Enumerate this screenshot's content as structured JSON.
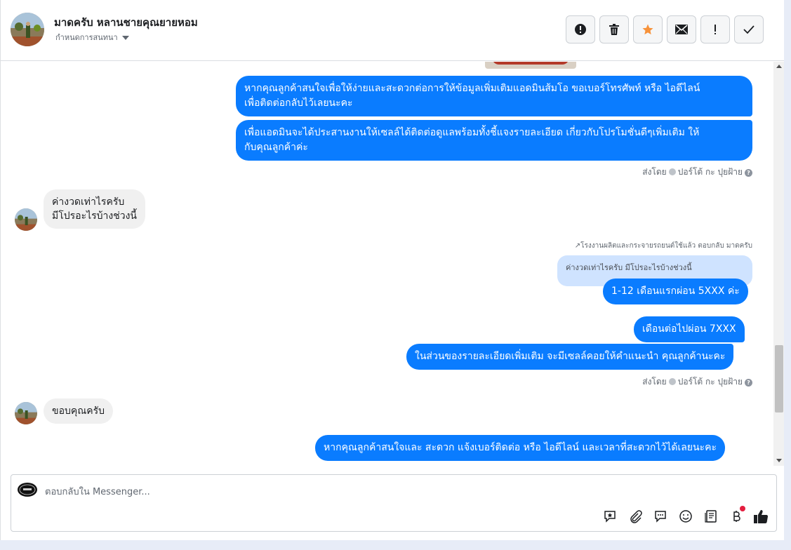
{
  "header": {
    "name": "มาดครับ หลานชายคุณยายหอม",
    "subtitle": "กำหนดการสนทนา"
  },
  "toolbar": {
    "buttons": [
      "alert-icon",
      "trash-icon",
      "star-icon",
      "mail-icon",
      "exclamation-icon",
      "check-icon"
    ],
    "colors": {
      "star": "#f7923a",
      "default": "#1c1e21"
    }
  },
  "conversation": {
    "out_1_line1": "หากคุณลูกค้าสนใจเพื่อให้ง่ายและสะดวกต่อการให้ข้อมูลเพิ่มเติมแอดมินส้มโอ ขอเบอร์โทรศัพท์ หรือ ไอดีไลน์",
    "out_1_line2": "เพื่อติดต่อกลับไว้เลยนะคะ",
    "out_2_line1": "เพื่อแอดมินจะได้ประสานงานให้เซลล์ได้ติดต่อดูแลพร้อมทั้งชี้แจงรายละเอียด เกี่ยวกับโปรโมชั่นดีๆเพิ่มเติม ให้",
    "out_2_line2": "กับคุณลูกค้าค่ะ",
    "sent_by_1": "ส่งโดย",
    "sent_by_name_1": "ปอร์โต้ กะ ปุยฝ้าย",
    "in_1_line1": "ค่างวดเท่าไรครับ",
    "in_1_line2": "มีโปรอะไรบ้างช่วงนี้",
    "reply_note": "โรงงานผลิตและกระจายรถยนต์ใช้แล้ว ตอบกลับ มาดครับ",
    "quoted_text": "ค่างวดเท่าไรครับ มีโปรอะไรบ้างช่วงนี้",
    "out_3": "1-12 เดือนแรกผ่อน 5XXX ค่ะ",
    "out_4": "เดือนต่อไปผ่อน 7XXX",
    "out_5": "ในส่วนของรายละเอียดเพิ่มเติม จะมีเซลล์คอยให้คำแนะนำ คุณลูกค้านะคะ",
    "sent_by_2": "ส่งโดย",
    "sent_by_name_2": "ปอร์โต้ กะ ปุยฝ้าย",
    "in_2": "ขอบคุณครับ",
    "out_6": "หากคุณลูกค้าสนใจและ สะดวก แจ้งเบอร์ติดต่อ หรือ ไอดีไลน์ และเวลาที่สะดวกไว้ได้เลยนะคะ"
  },
  "composer": {
    "placeholder": "ตอบกลับใน Messenger...",
    "tools": [
      "sticker-reply-icon",
      "attachment-icon",
      "saved-reply-icon",
      "emoji-icon",
      "notes-icon",
      "baht-payment-icon",
      "like-icon"
    ]
  },
  "colors": {
    "outgoing_bubble": "#0a7cff",
    "incoming_bubble": "#f0f0f0",
    "quote_bubble": "#cfe3ff",
    "notification_dot": "#e41e3f"
  }
}
